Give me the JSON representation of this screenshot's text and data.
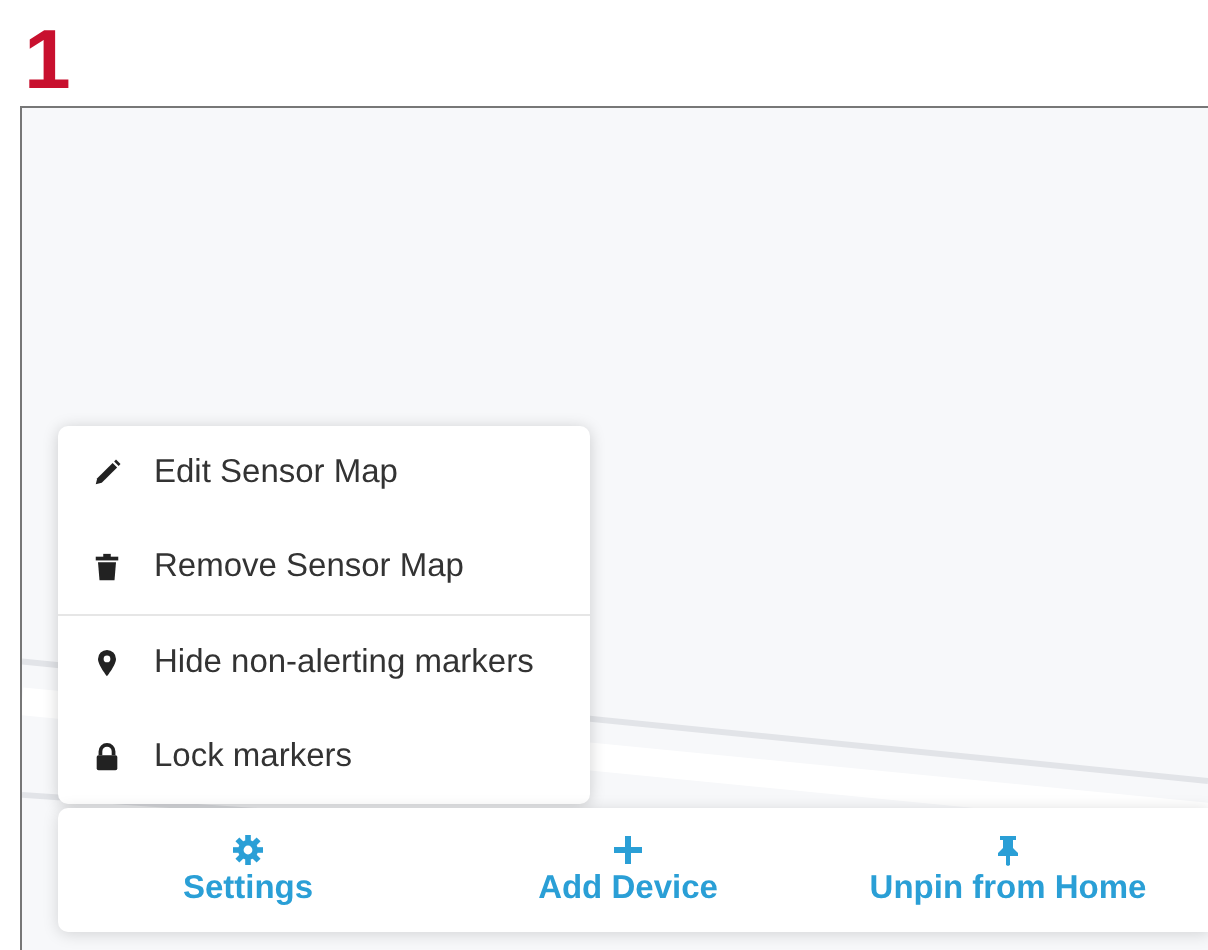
{
  "step": {
    "number": "1"
  },
  "menu": {
    "groups": [
      {
        "items": [
          {
            "label": "Edit Sensor Map"
          },
          {
            "label": "Remove Sensor Map"
          }
        ]
      },
      {
        "items": [
          {
            "label": "Hide non-alerting markers"
          },
          {
            "label": "Lock markers"
          }
        ]
      }
    ]
  },
  "action_bar": {
    "buttons": [
      {
        "label": "Settings"
      },
      {
        "label": "Add Device"
      },
      {
        "label": "Unpin from Home"
      }
    ]
  }
}
